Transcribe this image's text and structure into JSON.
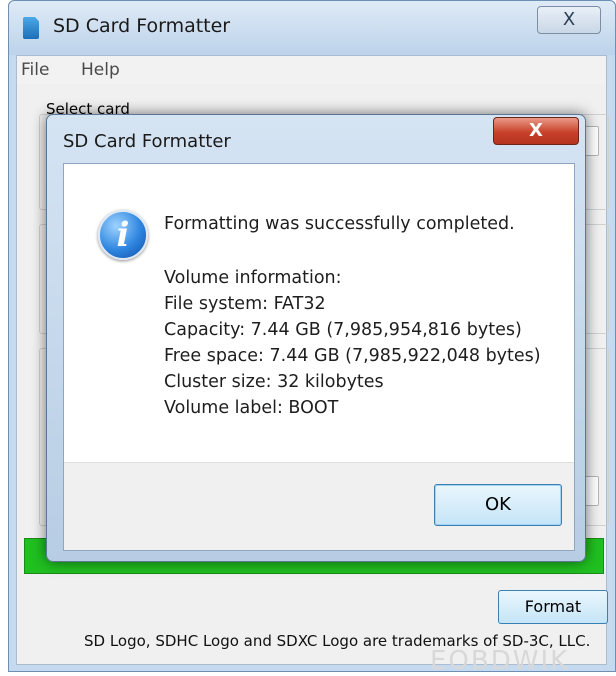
{
  "main_window": {
    "title": "SD Card Formatter",
    "close_glyph": "X",
    "menu": [
      "File",
      "Help"
    ],
    "select_card_label": "Select card",
    "format_button": "Format",
    "footer_note": "SD Logo, SDHC Logo and SDXC Logo are trademarks of SD-3C, LLC.",
    "progress": 1.0,
    "progress_color": "#20c020"
  },
  "dialog": {
    "title": "SD Card Formatter",
    "close_glyph": "X",
    "icon": "info-icon",
    "message": "Formatting was successfully completed.",
    "volume_info": {
      "heading": "Volume information:",
      "file_system": "File system: FAT32",
      "capacity": "Capacity: 7.44 GB (7,985,954,816 bytes)",
      "free_space": "Free space: 7.44 GB (7,985,922,048 bytes)",
      "cluster_size": "Cluster size: 32 kilobytes",
      "volume_label": "Volume label: BOOT"
    },
    "ok_button": "OK"
  },
  "watermark": "EOBDWIK"
}
